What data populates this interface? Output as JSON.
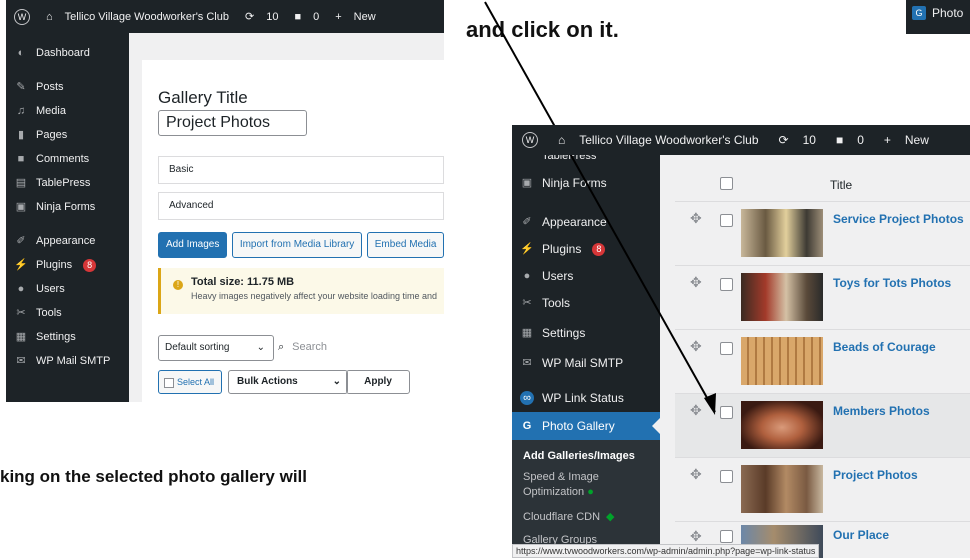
{
  "doc": {
    "top_instruction": "and click on it.",
    "bottom_text": "king on the selected photo gallery will"
  },
  "left_shot": {
    "adminbar": {
      "site": "Tellico Village Woodworker's Club",
      "updates": "10",
      "comments": "0",
      "new": "New"
    },
    "menu": [
      {
        "label": "Dashboard",
        "icon": "dashboard-icon"
      },
      {
        "label": "Posts",
        "icon": "pin-icon"
      },
      {
        "label": "Media",
        "icon": "media-icon"
      },
      {
        "label": "Pages",
        "icon": "pages-icon"
      },
      {
        "label": "Comments",
        "icon": "comment-icon"
      },
      {
        "label": "TablePress",
        "icon": "table-icon"
      },
      {
        "label": "Ninja Forms",
        "icon": "forms-icon"
      },
      {
        "label": "Appearance",
        "icon": "brush-icon"
      },
      {
        "label": "Plugins",
        "icon": "plug-icon",
        "badge": "8"
      },
      {
        "label": "Users",
        "icon": "user-icon"
      },
      {
        "label": "Tools",
        "icon": "wrench-icon"
      },
      {
        "label": "Settings",
        "icon": "settings-icon"
      },
      {
        "label": "WP Mail SMTP",
        "icon": "mail-icon"
      }
    ],
    "gallery_title_label": "Gallery Title",
    "gallery_title_value": "Project Photos",
    "tab_basic": "Basic",
    "tab_advanced": "Advanced",
    "btn_add_images": "Add Images",
    "btn_import": "Import from Media Library",
    "btn_embed": "Embed Media",
    "notice_title": "Total size: 11.75 MB",
    "notice_text": "Heavy images negatively affect your website loading time and",
    "sort_value": "Default sorting",
    "search_placeholder": "Search",
    "select_all": "Select All",
    "bulk_actions": "Bulk Actions",
    "apply": "Apply"
  },
  "right_shot": {
    "adminbar": {
      "site": "Tellico Village Woodworker's Club",
      "updates": "10",
      "comments": "0",
      "new": "New"
    },
    "menu": [
      {
        "label": "TablePress",
        "icon": "table-icon"
      },
      {
        "label": "Ninja Forms",
        "icon": "forms-icon"
      },
      {
        "label": "Appearance",
        "icon": "brush-icon"
      },
      {
        "label": "Plugins",
        "icon": "plug-icon",
        "badge": "8"
      },
      {
        "label": "Users",
        "icon": "user-icon"
      },
      {
        "label": "Tools",
        "icon": "wrench-icon"
      },
      {
        "label": "Settings",
        "icon": "settings-icon"
      },
      {
        "label": "WP Mail SMTP",
        "icon": "mail-icon"
      },
      {
        "label": "WP Link Status",
        "icon": "link-icon"
      },
      {
        "label": "Photo Gallery",
        "icon": "gallery-icon"
      }
    ],
    "submenu": [
      {
        "label": "Add Galleries/Images"
      },
      {
        "label": "Speed & Image Optimization"
      },
      {
        "label": "Cloudflare CDN"
      },
      {
        "label": "Gallery Groups"
      }
    ],
    "col_title": "Title",
    "galleries": [
      {
        "title": "Service Project Photos"
      },
      {
        "title": "Toys for Tots Photos"
      },
      {
        "title": "Beads of Courage"
      },
      {
        "title": "Members Photos"
      },
      {
        "title": "Project Photos"
      },
      {
        "title": "Our Place"
      }
    ],
    "status_url": "https://www.tvwoodworkers.com/wp-admin/admin.php?page=wp-link-status"
  },
  "corner_label": "Photo"
}
